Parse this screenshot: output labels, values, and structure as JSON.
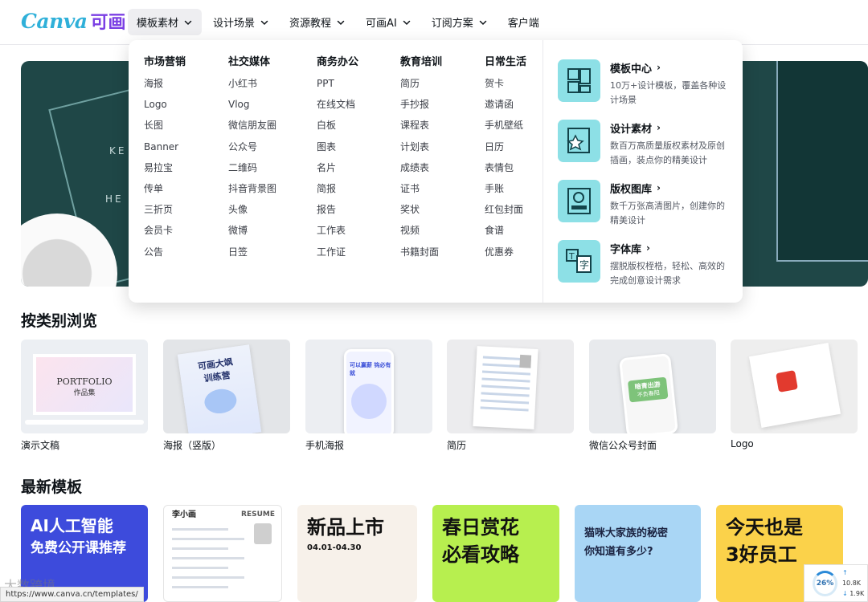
{
  "logo": {
    "brand": "Canva",
    "cn": "可画"
  },
  "nav": [
    {
      "label": "模板素材",
      "dropdown": true
    },
    {
      "label": "设计场景",
      "dropdown": true
    },
    {
      "label": "资源教程",
      "dropdown": true
    },
    {
      "label": "可画AI",
      "dropdown": true
    },
    {
      "label": "订阅方案",
      "dropdown": true
    },
    {
      "label": "客户端",
      "dropdown": false
    }
  ],
  "hero": {
    "line1": "KE",
    "line2": "HE"
  },
  "mega": {
    "columns": [
      {
        "title": "市场营销",
        "items": [
          "海报",
          "Logo",
          "长图",
          "Banner",
          "易拉宝",
          "传单",
          "三折页",
          "会员卡",
          "公告"
        ]
      },
      {
        "title": "社交媒体",
        "items": [
          "小红书",
          "Vlog",
          "微信朋友圈",
          "公众号",
          "二维码",
          "抖音背景图",
          "头像",
          "微博",
          "日签"
        ]
      },
      {
        "title": "商务办公",
        "items": [
          "PPT",
          "在线文档",
          "白板",
          "图表",
          "名片",
          "简报",
          "报告",
          "工作表",
          "工作证"
        ]
      },
      {
        "title": "教育培训",
        "items": [
          "简历",
          "手抄报",
          "课程表",
          "计划表",
          "成绩表",
          "证书",
          "奖状",
          "视频",
          "书籍封面"
        ]
      },
      {
        "title": "日常生活",
        "items": [
          "贺卡",
          "邀请函",
          "手机壁纸",
          "日历",
          "表情包",
          "手账",
          "红包封面",
          "食谱",
          "优惠券"
        ]
      }
    ],
    "features": [
      {
        "title": "模板中心",
        "desc": "10万+设计模板，覆盖各种设计场景",
        "icon": "template-center-icon"
      },
      {
        "title": "设计素材",
        "desc": "数百万高质量版权素材及原创插画，装点你的精美设计",
        "icon": "design-assets-icon"
      },
      {
        "title": "版权图库",
        "desc": "数千万张高清图片，创建你的精美设计",
        "icon": "photo-library-icon"
      },
      {
        "title": "字体库",
        "desc": "摆脱版权桎梏，轻松、高效的完成创意设计需求",
        "icon": "font-library-icon"
      }
    ]
  },
  "browse": {
    "title": "按类别浏览",
    "cards": [
      {
        "label": "演示文稿",
        "thumb_title": "PORTFOLIO",
        "thumb_sub": "作品集"
      },
      {
        "label": "海报（竖版）",
        "thumb_title": "可画大飒",
        "thumb_sub": "训练营"
      },
      {
        "label": "手机海报",
        "thumb_title": "可以赢薪 钩必有就",
        "thumb_sub": ""
      },
      {
        "label": "简历",
        "thumb_title": "",
        "thumb_sub": ""
      },
      {
        "label": "微信公众号封面",
        "thumb_title": "暗青出游",
        "thumb_sub": "不负春阳"
      },
      {
        "label": "Logo",
        "thumb_title": "",
        "thumb_sub": ""
      }
    ]
  },
  "latest": {
    "title": "最新模板",
    "cards": [
      {
        "line1": "AI人工智能",
        "line2": "免费公开课推荐",
        "bg": "#3d4bdc"
      },
      {
        "line1": "李小画",
        "line2": "RESUME",
        "bg": "#ffffff"
      },
      {
        "line1": "新品上市",
        "line2": "04.01-04.30",
        "bg": "#f7f1ea"
      },
      {
        "line1": "春日赏花",
        "line2": "必看攻略",
        "bg": "#b7ef4f"
      },
      {
        "line1": "猫咪大家族的秘密",
        "line2": "你知道有多少?",
        "bg": "#a9d6f5"
      },
      {
        "line1": "今天也是",
        "line2": "3好员工",
        "bg": "#fbd24a"
      }
    ]
  },
  "status": {
    "url": "https://www.canva.cn/templates/"
  },
  "watermark": {
    "text": "大数跨境"
  },
  "speed": {
    "percent": "26%",
    "up": "10.8K",
    "down": "1.9K"
  }
}
